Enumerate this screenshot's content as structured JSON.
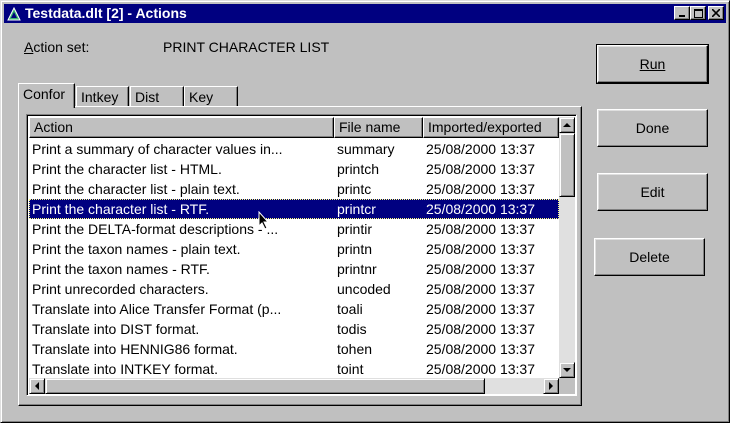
{
  "window": {
    "title": "Testdata.dlt [2] - Actions",
    "minimize": "_",
    "maximize": "□",
    "close": "✕"
  },
  "action_set": {
    "label": "Action set:",
    "value": "PRINT CHARACTER LIST"
  },
  "tabs": [
    {
      "label": "Confor",
      "active": true
    },
    {
      "label": "Intkey",
      "active": false
    },
    {
      "label": "Dist",
      "active": false
    },
    {
      "label": "Key",
      "active": false
    }
  ],
  "table": {
    "columns": [
      "Action",
      "File name",
      "Imported/exported"
    ],
    "rows": [
      {
        "action": "Print a summary of character values in...",
        "file": "summary",
        "date": "25/08/2000 13:37"
      },
      {
        "action": "Print the character list - HTML.",
        "file": "printch",
        "date": "25/08/2000 13:37"
      },
      {
        "action": "Print the character list - plain text.",
        "file": "printc",
        "date": "25/08/2000 13:37"
      },
      {
        "action": "Print the character list - RTF.",
        "file": "printcr",
        "date": "25/08/2000 13:37",
        "selected": true
      },
      {
        "action": "Print the DELTA-format descriptions - ...",
        "file": "printir",
        "date": "25/08/2000 13:37"
      },
      {
        "action": "Print the taxon names - plain text.",
        "file": "printn",
        "date": "25/08/2000 13:37"
      },
      {
        "action": "Print the taxon names - RTF.",
        "file": "printnr",
        "date": "25/08/2000 13:37"
      },
      {
        "action": "Print unrecorded characters.",
        "file": "uncoded",
        "date": "25/08/2000 13:37"
      },
      {
        "action": "Translate into Alice Transfer Format (p...",
        "file": "toali",
        "date": "25/08/2000 13:37"
      },
      {
        "action": "Translate into DIST format.",
        "file": "todis",
        "date": "25/08/2000 13:37"
      },
      {
        "action": "Translate into HENNIG86 format.",
        "file": "tohen",
        "date": "25/08/2000 13:37"
      },
      {
        "action": "Translate into INTKEY format.",
        "file": "toint",
        "date": "25/08/2000 13:37"
      }
    ]
  },
  "buttons": {
    "run": "Run",
    "done": "Done",
    "edit": "Edit",
    "delete": "Delete"
  }
}
